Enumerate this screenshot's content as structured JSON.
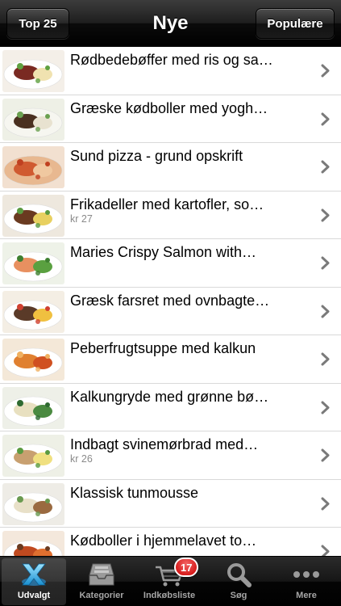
{
  "navbar": {
    "left_button": "Top 25",
    "title": "Nye",
    "right_button": "Populære"
  },
  "recipes": [
    {
      "title": "Rødbedebøffer med ris og sa…",
      "sub": "",
      "thumb": "steak-plate"
    },
    {
      "title": "Græske kødboller med yogh…",
      "sub": "",
      "thumb": "meatballs-plate"
    },
    {
      "title": "Sund pizza - grund opskrift",
      "sub": "",
      "thumb": "pizza-slice"
    },
    {
      "title": "Frikadeller med kartofler, so…",
      "sub": "kr 27",
      "thumb": "frikadeller-potatoes"
    },
    {
      "title": "Maries Crispy Salmon with…",
      "sub": "",
      "thumb": "salmon-peas"
    },
    {
      "title": "Græsk farsret med ovnbagte…",
      "sub": "",
      "thumb": "greek-mince"
    },
    {
      "title": "Peberfrugtsuppe med kalkun",
      "sub": "",
      "thumb": "pepper-soup"
    },
    {
      "title": "Kalkungryde med grønne bø…",
      "sub": "",
      "thumb": "turkey-stew"
    },
    {
      "title": "Indbagt svinemørbrad med…",
      "sub": "kr 26",
      "thumb": "pork-potatoes"
    },
    {
      "title": "Klassisk tunmousse",
      "sub": "",
      "thumb": "tuna-mousse"
    },
    {
      "title": "Kødboller i hjemmelavet to…",
      "sub": "",
      "thumb": "meatballs-tomato"
    }
  ],
  "tabbar": {
    "tabs": [
      {
        "label": "Udvalgt",
        "icon": "featured-x-icon",
        "selected": true
      },
      {
        "label": "Kategorier",
        "icon": "inbox-tray-icon",
        "selected": false
      },
      {
        "label": "Indkøbsliste",
        "icon": "shopping-cart-icon",
        "selected": false,
        "badge": "17"
      },
      {
        "label": "Søg",
        "icon": "search-icon",
        "selected": false
      },
      {
        "label": "Mere",
        "icon": "more-dots-icon",
        "selected": false
      }
    ]
  },
  "colors": {
    "badge": "#cc0000",
    "list_separator": "#d9d9d9",
    "subtitle": "#8a8a8a",
    "chevron": "#7a7a7a"
  }
}
